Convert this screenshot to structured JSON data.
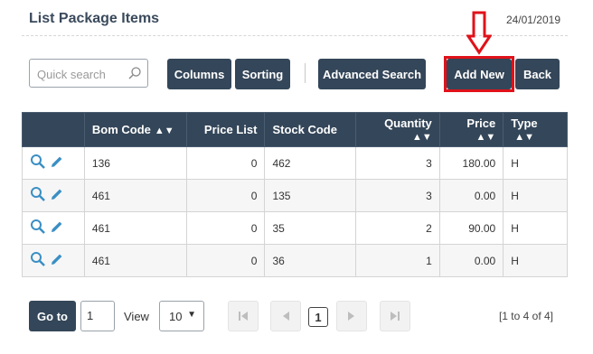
{
  "header": {
    "title": "List Package Items",
    "date": "24/01/2019"
  },
  "search": {
    "placeholder": "Quick search"
  },
  "toolbar": {
    "columns_label": "Columns",
    "sorting_label": "Sorting",
    "advanced_search_label": "Advanced Search",
    "add_new_label": "Add New",
    "back_label": "Back"
  },
  "annotation": {
    "highlight_color": "#e0121a",
    "arrow": "down-arrow-icon"
  },
  "table": {
    "headers": [
      "Bom Code",
      "Price List",
      "Stock Code",
      "Quantity",
      "Price",
      "Type"
    ],
    "rows": [
      {
        "bom_code": "136",
        "price_list": "0",
        "stock_code": "462",
        "quantity": "3",
        "price": "180.00",
        "type": "H"
      },
      {
        "bom_code": "461",
        "price_list": "0",
        "stock_code": "135",
        "quantity": "3",
        "price": "0.00",
        "type": "H"
      },
      {
        "bom_code": "461",
        "price_list": "0",
        "stock_code": "35",
        "quantity": "2",
        "price": "90.00",
        "type": "H"
      },
      {
        "bom_code": "461",
        "price_list": "0",
        "stock_code": "36",
        "quantity": "1",
        "price": "0.00",
        "type": "H"
      }
    ]
  },
  "pagination": {
    "goto_label": "Go to",
    "page_input": "1",
    "view_label": "View",
    "view_value": "10",
    "current_page": "1",
    "range_text": "[1 to 4 of 4]"
  },
  "colors": {
    "primary": "#344659",
    "icon": "#3a8fc4"
  }
}
